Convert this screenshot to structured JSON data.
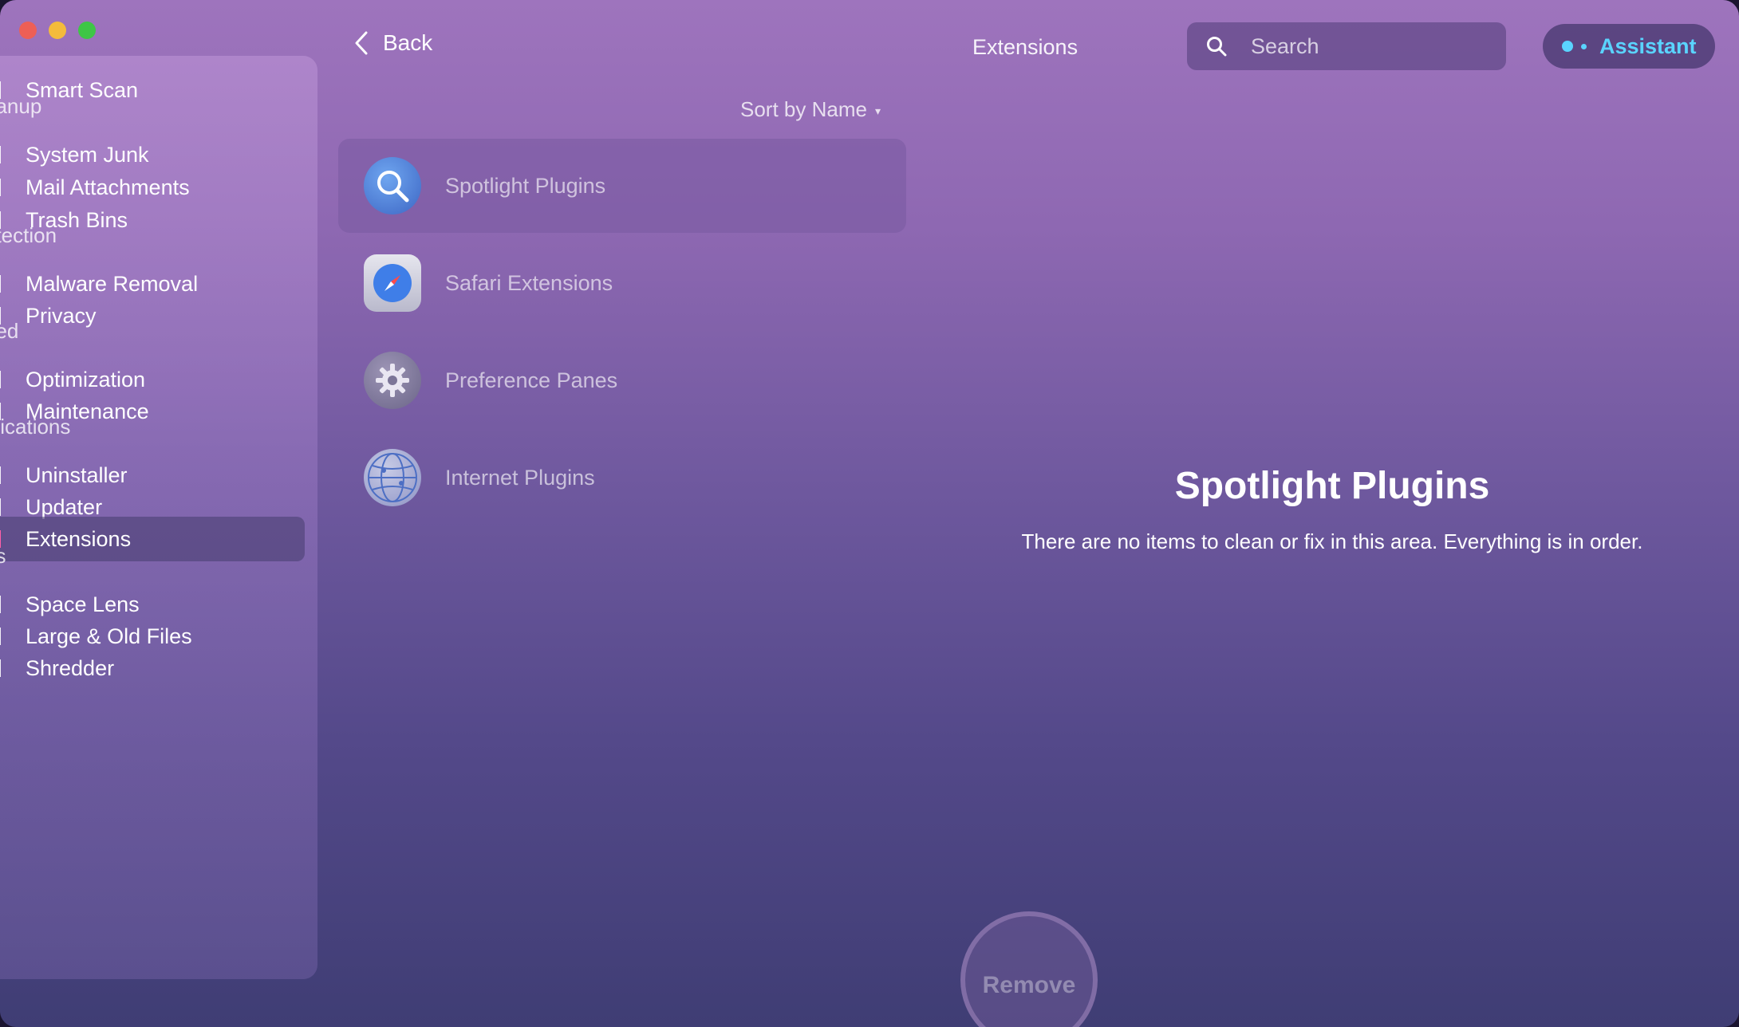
{
  "window": {
    "title": "Extensions"
  },
  "sidebar": {
    "items": [
      {
        "label": "Smart Scan"
      },
      {
        "section": "eanup"
      },
      {
        "label": "System Junk"
      },
      {
        "label": "Mail Attachments"
      },
      {
        "label": "Trash Bins"
      },
      {
        "section": "otection"
      },
      {
        "label": "Malware Removal"
      },
      {
        "label": "Privacy"
      },
      {
        "section": "eed"
      },
      {
        "label": "Optimization"
      },
      {
        "label": "Maintenance"
      },
      {
        "section": "plications"
      },
      {
        "label": "Uninstaller"
      },
      {
        "label": "Updater"
      },
      {
        "label": "Extensions",
        "active": true
      },
      {
        "section": "es"
      },
      {
        "label": "Space Lens"
      },
      {
        "label": "Large & Old Files"
      },
      {
        "label": "Shredder"
      }
    ]
  },
  "toolbar": {
    "back_label": "Back",
    "search_placeholder": "Search",
    "assistant_label": "Assistant"
  },
  "sort": {
    "label": "Sort by Name",
    "caret": "▾"
  },
  "extensions": [
    {
      "label": "Spotlight Plugins",
      "icon": "spotlight-icon",
      "selected": true
    },
    {
      "label": "Safari Extensions",
      "icon": "safari-icon"
    },
    {
      "label": "Preference Panes",
      "icon": "gear-icon"
    },
    {
      "label": "Internet Plugins",
      "icon": "globe-icon"
    }
  ],
  "detail": {
    "title": "Spotlight Plugins",
    "message": "There are no items to clean or fix in this area. Everything is in order."
  },
  "actions": {
    "remove_label": "Remove"
  },
  "colors": {
    "accent": "#5ad4ff",
    "active_marker": "#ff5fa8"
  }
}
